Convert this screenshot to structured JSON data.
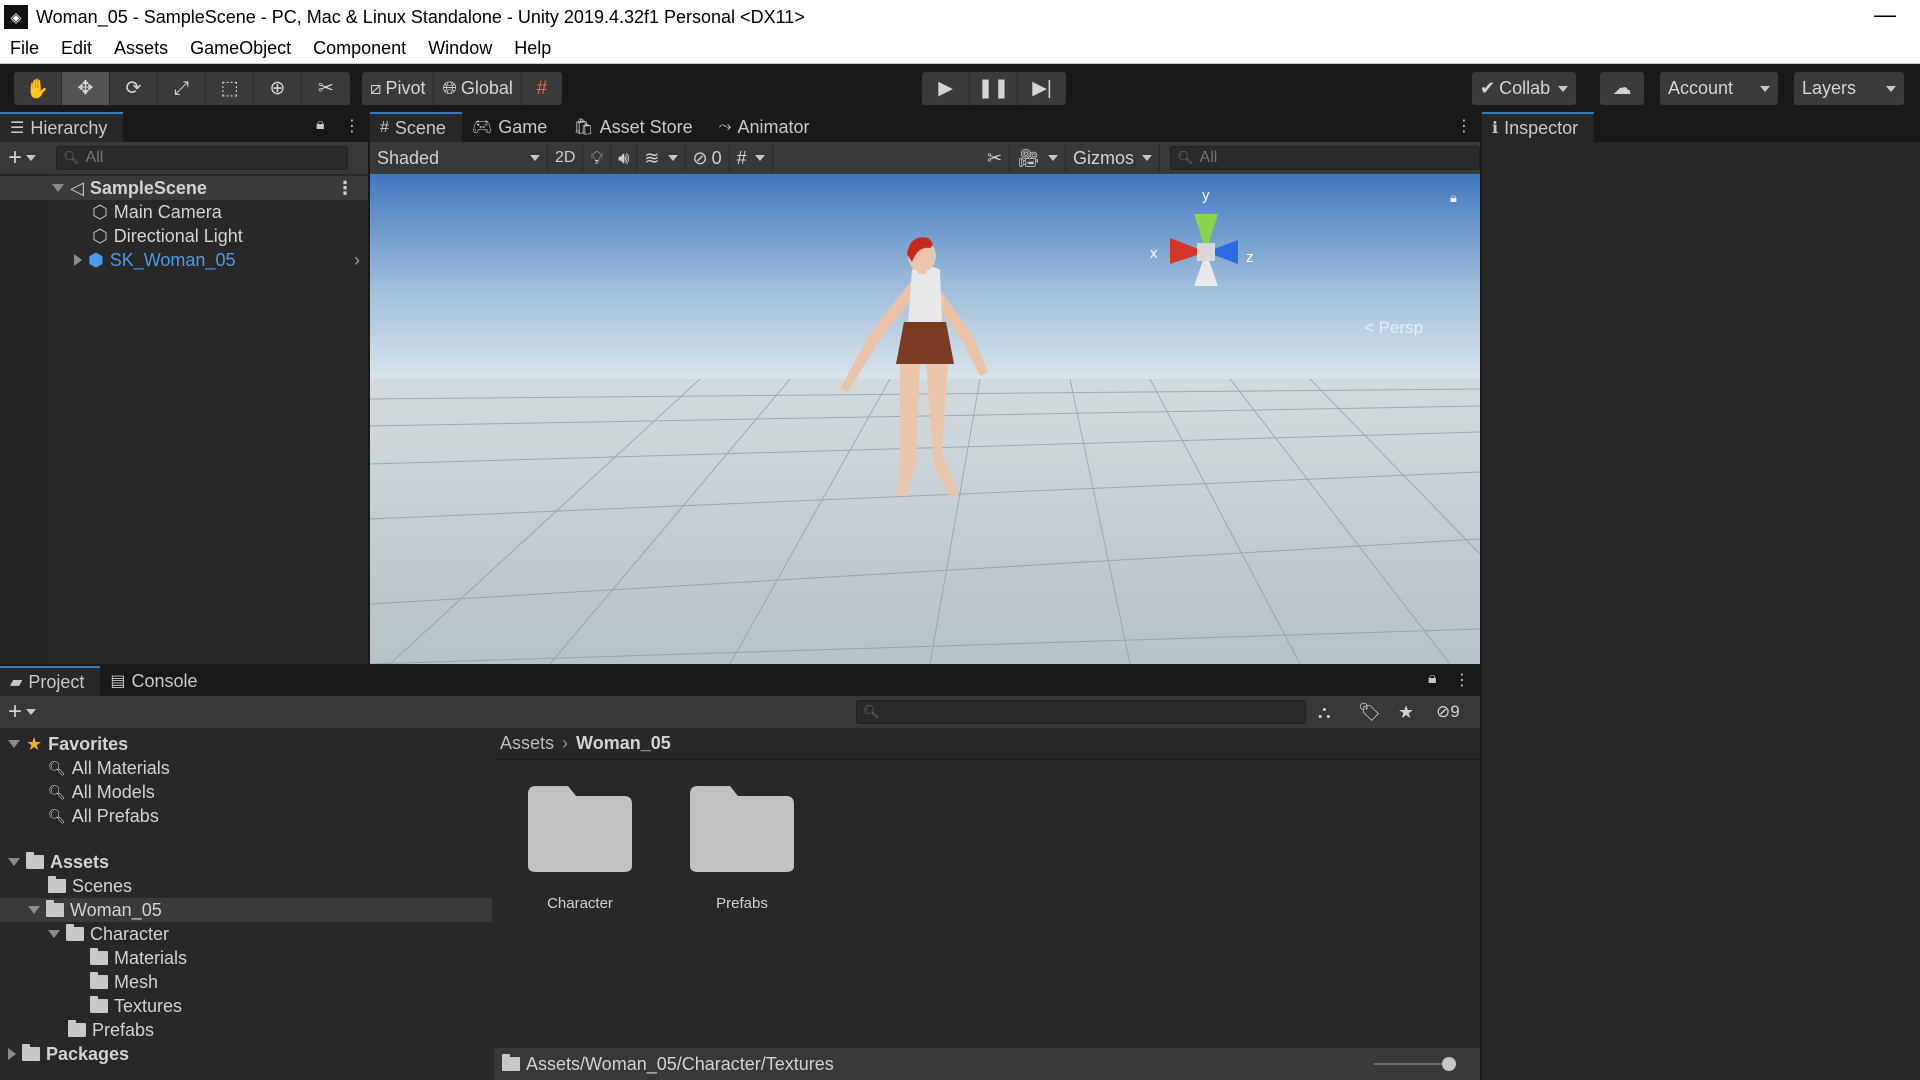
{
  "window": {
    "title": "Woman_05 - SampleScene - PC, Mac & Linux Standalone - Unity 2019.4.32f1 Personal <DX11>"
  },
  "menu": [
    "File",
    "Edit",
    "Assets",
    "GameObject",
    "Component",
    "Window",
    "Help"
  ],
  "toolbar": {
    "pivot_label": "Pivot",
    "global_label": "Global",
    "collab_label": "Collab",
    "account_label": "Account",
    "layers_label": "Layers"
  },
  "hierarchy": {
    "tab_label": "Hierarchy",
    "search_placeholder": "All",
    "scene_name": "SampleScene",
    "items": [
      "Main Camera",
      "Directional Light",
      "SK_Woman_05"
    ]
  },
  "scene": {
    "tabs": [
      "Scene",
      "Game",
      "Asset Store",
      "Animator"
    ],
    "shading_mode": "Shaded",
    "mode_2d": "2D",
    "hidden_count": "0",
    "gizmos_label": "Gizmos",
    "search_placeholder": "All",
    "gizmo_axes": {
      "x": "x",
      "y": "y",
      "z": "z"
    },
    "persp_label": "Persp"
  },
  "inspector": {
    "tab_label": "Inspector"
  },
  "project": {
    "tabs": [
      "Project",
      "Console"
    ],
    "hidden_count": "9",
    "favorites": {
      "label": "Favorites",
      "items": [
        "All Materials",
        "All Models",
        "All Prefabs"
      ]
    },
    "tree": {
      "assets": "Assets",
      "scenes": "Scenes",
      "woman": "Woman_05",
      "character": "Character",
      "materials": "Materials",
      "mesh": "Mesh",
      "textures": "Textures",
      "prefabs": "Prefabs",
      "packages": "Packages"
    },
    "breadcrumb": [
      "Assets",
      "Woman_05"
    ],
    "folders": [
      "Character",
      "Prefabs"
    ],
    "status_path": "Assets/Woman_05/Character/Textures"
  },
  "colors": {
    "accent": "#3a79bb",
    "selected_object": "#4d9be6",
    "sky_top": "#3f78c0",
    "ground": "#b6c3c7"
  }
}
